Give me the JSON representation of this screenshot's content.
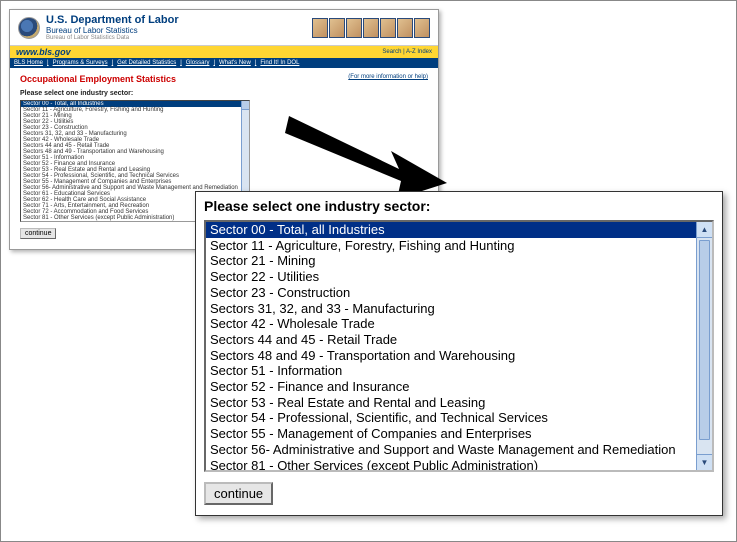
{
  "header": {
    "dept_title": "U.S. Department of Labor",
    "bureau": "Bureau of Labor Statistics",
    "subtitle": "Bureau of Labor Statistics Data",
    "url_label": "www.bls.gov",
    "search_label": "Search",
    "az_label": "A-Z Index"
  },
  "nav": {
    "items": [
      "BLS Home",
      "Programs & Surveys",
      "Get Detailed Statistics",
      "Glossary",
      "What's New",
      "Find It! In DOL"
    ]
  },
  "page": {
    "title": "Occupational Employment Statistics",
    "help": "(For more information or help)",
    "prompt": "Please select one industry sector:",
    "continue_label": "continue"
  },
  "sectors": [
    "Sector 00 - Total, all Industries",
    "Sector 11 - Agriculture, Forestry, Fishing and Hunting",
    "Sector 21 - Mining",
    "Sector 22 - Utilities",
    "Sector 23 - Construction",
    "Sectors 31, 32, and 33 - Manufacturing",
    "Sector 42 - Wholesale Trade",
    "Sectors 44 and 45 - Retail Trade",
    "Sectors 48 and 49 - Transportation and Warehousing",
    "Sector 51 - Information",
    "Sector 52 - Finance and Insurance",
    "Sector 53 - Real Estate and Rental and Leasing",
    "Sector 54 - Professional, Scientific, and Technical Services",
    "Sector 55 - Management of Companies and Enterprises",
    "Sector 56- Administrative and Support and Waste Management and Remediation",
    "Sector 81 - Other Services (except Public Administration)"
  ],
  "bg_sectors": [
    "Sector 00 - Total, all Industries",
    "Sector 11 - Agriculture, Forestry, Fishing and Hunting",
    "Sector 21 - Mining",
    "Sector 22 - Utilities",
    "Sector 23 - Construction",
    "Sectors 31, 32, and 33 - Manufacturing",
    "Sector 42 - Wholesale Trade",
    "Sectors 44 and 45 - Retail Trade",
    "Sectors 48 and 49 - Transportation and Warehousing",
    "Sector 51 - Information",
    "Sector 52 - Finance and Insurance",
    "Sector 53 - Real Estate and Rental and Leasing",
    "Sector 54 - Professional, Scientific, and Technical Services",
    "Sector 55 - Management of Companies and Enterprises",
    "Sector 56- Administrative and Support and Waste Management and Remediation",
    "Sector 61 - Educational Services",
    "Sector 62 - Health Care and Social Assistance",
    "Sector 71 - Arts, Entertainment, and Recreation",
    "Sector 72 - Accommodation and Food Services",
    "Sector 81 - Other Services (except Public Administration)"
  ],
  "selected_index": 0
}
